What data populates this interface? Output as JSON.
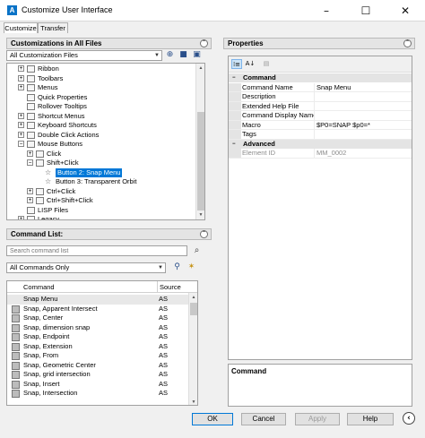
{
  "window": {
    "title": "Customize User Interface",
    "app_icon": "autocad-logo-icon",
    "controls": [
      "–",
      "☐",
      "✕"
    ]
  },
  "tabs": [
    {
      "label": "Customize",
      "active": true
    },
    {
      "label": "Transfer",
      "active": false
    }
  ],
  "customizations": {
    "header": "Customizations in All Files",
    "collapse_glyph": "⌃",
    "file_combo": "All Customization Files",
    "tree": [
      {
        "label": "Ribbon",
        "level": 1,
        "expander": "+"
      },
      {
        "label": "Toolbars",
        "level": 1,
        "expander": "+"
      },
      {
        "label": "Menus",
        "level": 1,
        "expander": "+"
      },
      {
        "label": "Quick Properties",
        "level": 1,
        "expander": ""
      },
      {
        "label": "Rollover Tooltips",
        "level": 1,
        "expander": ""
      },
      {
        "label": "Shortcut Menus",
        "level": 1,
        "expander": "+"
      },
      {
        "label": "Keyboard Shortcuts",
        "level": 1,
        "expander": "+"
      },
      {
        "label": "Double Click Actions",
        "level": 1,
        "expander": "+"
      },
      {
        "label": "Mouse Buttons",
        "level": 1,
        "expander": "−"
      },
      {
        "label": "Click",
        "level": 2,
        "expander": "+"
      },
      {
        "label": "Shift+Click",
        "level": 2,
        "expander": "−"
      },
      {
        "label": "Button 2: Snap Menu",
        "level": 3,
        "expander": "",
        "selected": true
      },
      {
        "label": "Button 3: Transparent Orbit",
        "level": 3,
        "expander": ""
      },
      {
        "label": "Ctrl+Click",
        "level": 2,
        "expander": "+"
      },
      {
        "label": "Ctrl+Shift+Click",
        "level": 2,
        "expander": "+"
      },
      {
        "label": "LISP Files",
        "level": 1,
        "expander": ""
      },
      {
        "label": "Legacy",
        "level": 1,
        "expander": "+"
      }
    ]
  },
  "command_list": {
    "header": "Command List:",
    "collapse_glyph": "⌃",
    "search_placeholder": "Search command list",
    "filter_combo": "All Commands Only",
    "col_command": "Command",
    "col_source": "Source",
    "rows": [
      {
        "command": "Snap Menu",
        "source": "AS",
        "icon": false,
        "highlight": true
      },
      {
        "command": "Snap, Apparent Intersect",
        "source": "AS",
        "icon": true
      },
      {
        "command": "Snap, Center",
        "source": "AS",
        "icon": true
      },
      {
        "command": "Snap, dimension snap",
        "source": "AS",
        "icon": true
      },
      {
        "command": "Snap, Endpoint",
        "source": "AS",
        "icon": true
      },
      {
        "command": "Snap, Extension",
        "source": "AS",
        "icon": true
      },
      {
        "command": "Snap, From",
        "source": "AS",
        "icon": true
      },
      {
        "command": "Snap, Geometric Center",
        "source": "AS",
        "icon": true
      },
      {
        "command": "Snap, grid intersection",
        "source": "AS",
        "icon": true
      },
      {
        "command": "Snap, Insert",
        "source": "AS",
        "icon": true
      },
      {
        "command": "Snap, Intersection",
        "source": "AS",
        "icon": true
      }
    ]
  },
  "properties": {
    "header": "Properties",
    "collapse_glyph": "⌃",
    "toolbar": {
      "categorized": "⁞≡",
      "alphabetical": "A↓",
      "pages": "▤"
    },
    "categories": [
      {
        "name": "Command",
        "expander": "−",
        "rows": [
          {
            "name": "Command Name",
            "value": "Snap Menu"
          },
          {
            "name": "Description",
            "value": ""
          },
          {
            "name": "Extended Help File",
            "value": ""
          },
          {
            "name": "Command Display Name",
            "value": ""
          },
          {
            "name": "Macro",
            "value": "$P0=SNAP $p0=*"
          },
          {
            "name": "Tags",
            "value": ""
          }
        ]
      },
      {
        "name": "Advanced",
        "expander": "−",
        "rows": [
          {
            "name": "Element ID",
            "value": "MM_0002",
            "disabled": true
          }
        ]
      }
    ],
    "description_title": "Command"
  },
  "buttons": {
    "ok": "OK",
    "cancel": "Cancel",
    "apply": "Apply",
    "help": "Help",
    "collapse_glyph": "‹"
  }
}
